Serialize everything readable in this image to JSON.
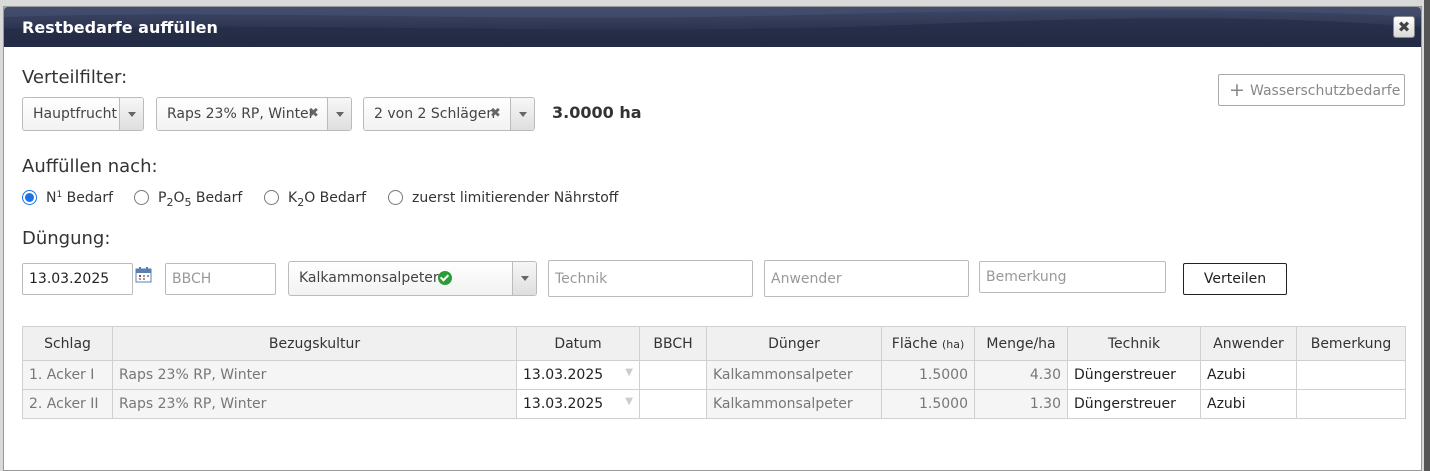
{
  "dialog": {
    "title": "Restbedarfe auffüllen",
    "close_label": "✖"
  },
  "filter": {
    "label": "Verteilfilter:",
    "select1": "Hauptfrucht",
    "select2": "Raps 23% RP, Winter",
    "select3": "2 von 2 Schlägen",
    "clear_glyph": "✖",
    "area": "3.0000 ha",
    "water_button": "Wasserschutzbedarfe",
    "water_plus": "+"
  },
  "fill": {
    "label": "Auffüllen nach:",
    "options": [
      {
        "pre": "N",
        "sup": "1",
        "post": " Bedarf",
        "checked": true
      },
      {
        "pre": "P",
        "sub1": "2",
        "mid": "O",
        "sub2": "5",
        "post": " Bedarf",
        "checked": false
      },
      {
        "pre": "K",
        "sub1": "2",
        "post": "O Bedarf",
        "checked": false
      },
      {
        "text": "zuerst limitierender Nährstoff",
        "checked": false
      }
    ]
  },
  "fert": {
    "label": "Düngung:",
    "date": "13.03.2025",
    "bbch_placeholder": "BBCH",
    "product": "Kalkammonsalpeter",
    "technik_placeholder": "Technik",
    "anwender_placeholder": "Anwender",
    "bemerkung_placeholder": "Bemerkung",
    "submit": "Verteilen"
  },
  "table": {
    "headers": {
      "schlag": "Schlag",
      "kultur": "Bezugskultur",
      "datum": "Datum",
      "bbch": "BBCH",
      "duenger": "Dünger",
      "flaeche": "Fläche",
      "flaeche_unit": "(ha)",
      "menge": "Menge/ha",
      "technik": "Technik",
      "anwender": "Anwender",
      "bemerkung": "Bemerkung"
    },
    "rows": [
      {
        "schlag": "1. Acker I",
        "kultur": "Raps 23% RP, Winter",
        "datum": "13.03.2025",
        "bbch": "",
        "duenger": "Kalkammonsalpeter",
        "flaeche": "1.5000",
        "menge": "4.30",
        "technik": "Düngerstreuer",
        "anwender": "Azubi",
        "bemerkung": ""
      },
      {
        "schlag": "2. Acker II",
        "kultur": "Raps 23% RP, Winter",
        "datum": "13.03.2025",
        "bbch": "",
        "duenger": "Kalkammonsalpeter",
        "flaeche": "1.5000",
        "menge": "1.30",
        "technik": "Düngerstreuer",
        "anwender": "Azubi",
        "bemerkung": ""
      }
    ]
  },
  "colors": {
    "titlebar": "#2c3451",
    "radio_accent": "#1a73e8",
    "ok_green": "#2a9d3a"
  }
}
